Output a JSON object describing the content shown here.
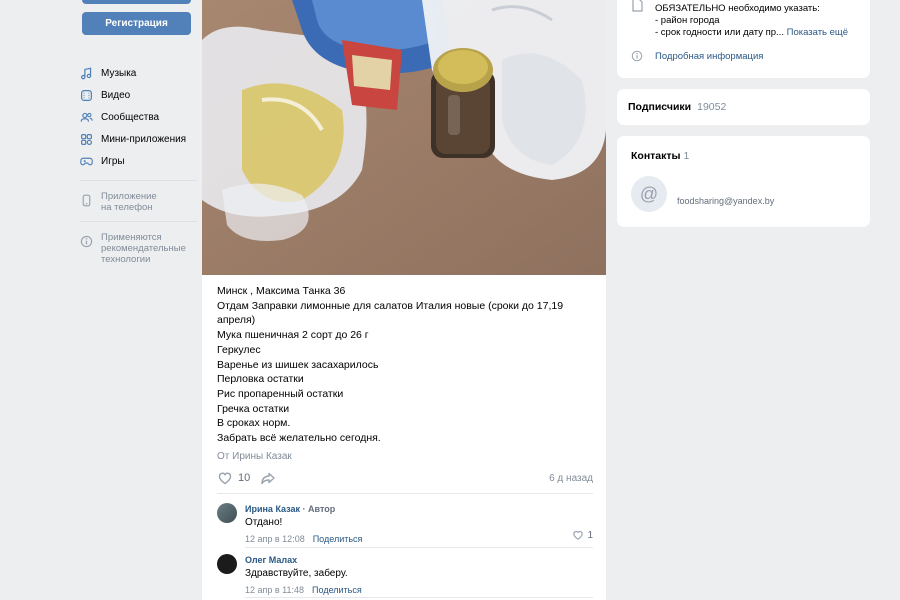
{
  "sidebar": {
    "register_label": "Регистрация",
    "items": [
      {
        "label": "Музыка",
        "icon": "music-icon"
      },
      {
        "label": "Видео",
        "icon": "video-icon"
      },
      {
        "label": "Сообщества",
        "icon": "communities-icon"
      },
      {
        "label": "Мини-приложения",
        "icon": "mini-apps-icon"
      },
      {
        "label": "Игры",
        "icon": "games-icon"
      }
    ],
    "app_link": "Приложение\nна телефон",
    "recommend_note": "Применяются\nрекомендательные\nтехнологии"
  },
  "post": {
    "lines": [
      "Минск , Максима Танка 36",
      "Отдам Заправки лимонные для салатов Италия новые (сроки до 17,19",
      "апреля)",
      "Мука пшеничная 2 сорт до 26 г",
      "Геркулес",
      "Варенье из шишек засахарилось",
      "Перловка остатки",
      "Рис пропаренный остатки",
      "Гречка остатки",
      "В сроках норм.",
      "Забрать всё желательно сегодня."
    ],
    "author": "От Ирины Казак",
    "likes": "10",
    "time_ago": "6 д назад"
  },
  "comments": [
    {
      "name": "Ирина Казак",
      "role": " · Автор",
      "text": "Отдано!",
      "date": "12 апр в 12:08",
      "reply": "Поделиться",
      "likes": "1"
    },
    {
      "name": "Олег Малах",
      "role": "",
      "text": "Здравствуйте, заберу.",
      "date": "12 апр в 11:48",
      "reply": "Поделиться",
      "likes": ""
    }
  ],
  "info": {
    "line1": "ОБЯЗАТЕЛЬНО необходимо указать:",
    "line2": "- район города",
    "line3": "- срок годности или дату пр...",
    "more": "Показать ещё",
    "details": "Подробная информация"
  },
  "subscribers": {
    "label": "Подписчики",
    "count": "19052"
  },
  "contacts": {
    "label": "Контакты",
    "count": "1",
    "email": "foodsharing@yandex.by"
  }
}
